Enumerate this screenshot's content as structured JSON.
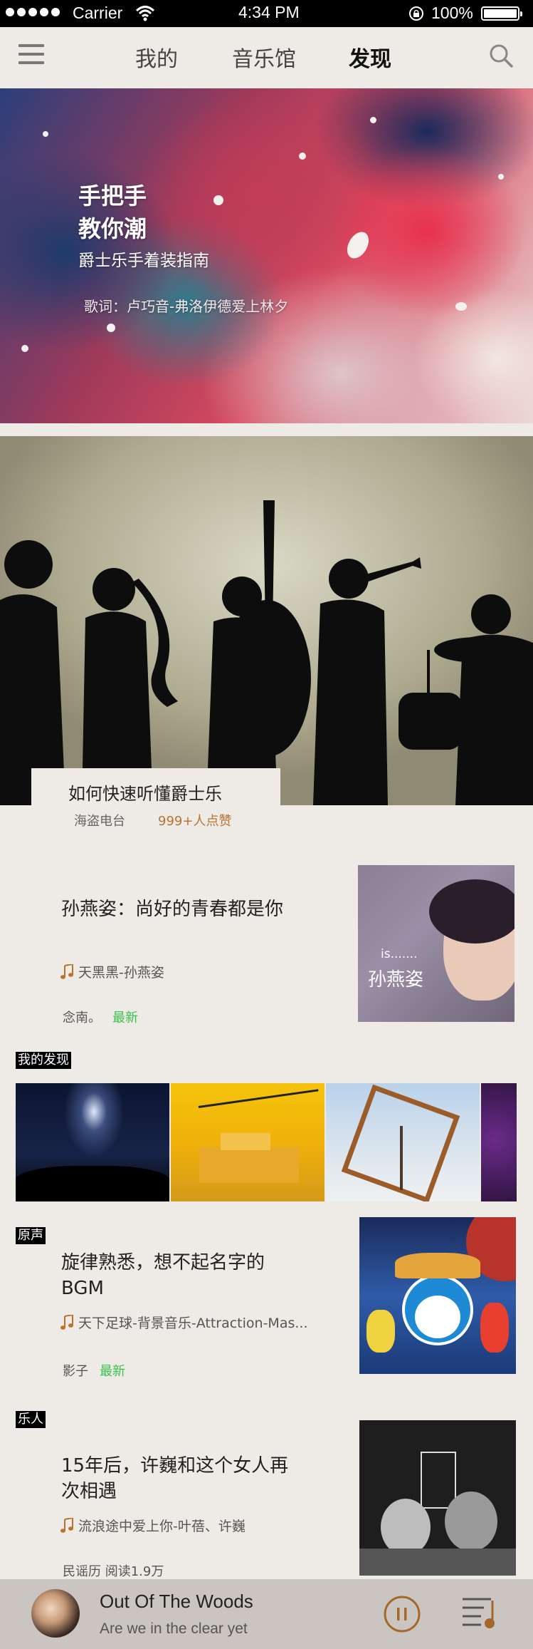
{
  "status_bar": {
    "carrier": "Carrier",
    "time": "4:34 PM",
    "battery": "100%"
  },
  "nav": {
    "tabs": [
      {
        "label": "我的"
      },
      {
        "label": "音乐馆"
      },
      {
        "label": "发现"
      }
    ],
    "active_tab": "发现",
    "icons": [
      "menu-icon",
      "search-icon"
    ]
  },
  "hero": {
    "title_line1": "手把手",
    "title_line2": "教你潮",
    "subtitle": "爵士乐手着装指南",
    "lyrics": "歌词：卢巧音-弗洛伊德爱上林夕"
  },
  "jazz_banner": {
    "title": "如何快速听懂爵士乐",
    "station": "海盗电台",
    "likes": "999+人点赞"
  },
  "article1": {
    "title": "孙燕姿：尚好的青春都是你",
    "song": "天黑黑-孙燕姿",
    "author": "念南。",
    "badge": "最新",
    "thumb_caption_small": "is.......",
    "thumb_caption": "孙燕姿"
  },
  "section_my_discovery": {
    "label": "我的发现"
  },
  "section_original": {
    "label": "原声",
    "title": "旋律熟悉，想不起名字的BGM",
    "song": "天下足球-背景音乐-Attraction-Mas...",
    "author": "影子",
    "badge": "最新"
  },
  "section_musician": {
    "label": "乐人",
    "title": "15年后，许巍和这个女人再次相遇",
    "song": "流浪途中爱上你-叶蓓、许巍",
    "meta": "民谣历 阅读1.9万"
  },
  "player": {
    "song": "Out Of The Woods",
    "artist": "Are we in the clear yet"
  },
  "colors": {
    "background": "#eeeae6",
    "accent_brown": "#b8732e",
    "new_green": "#39c34b",
    "player_bg": "#cbc5c1"
  }
}
